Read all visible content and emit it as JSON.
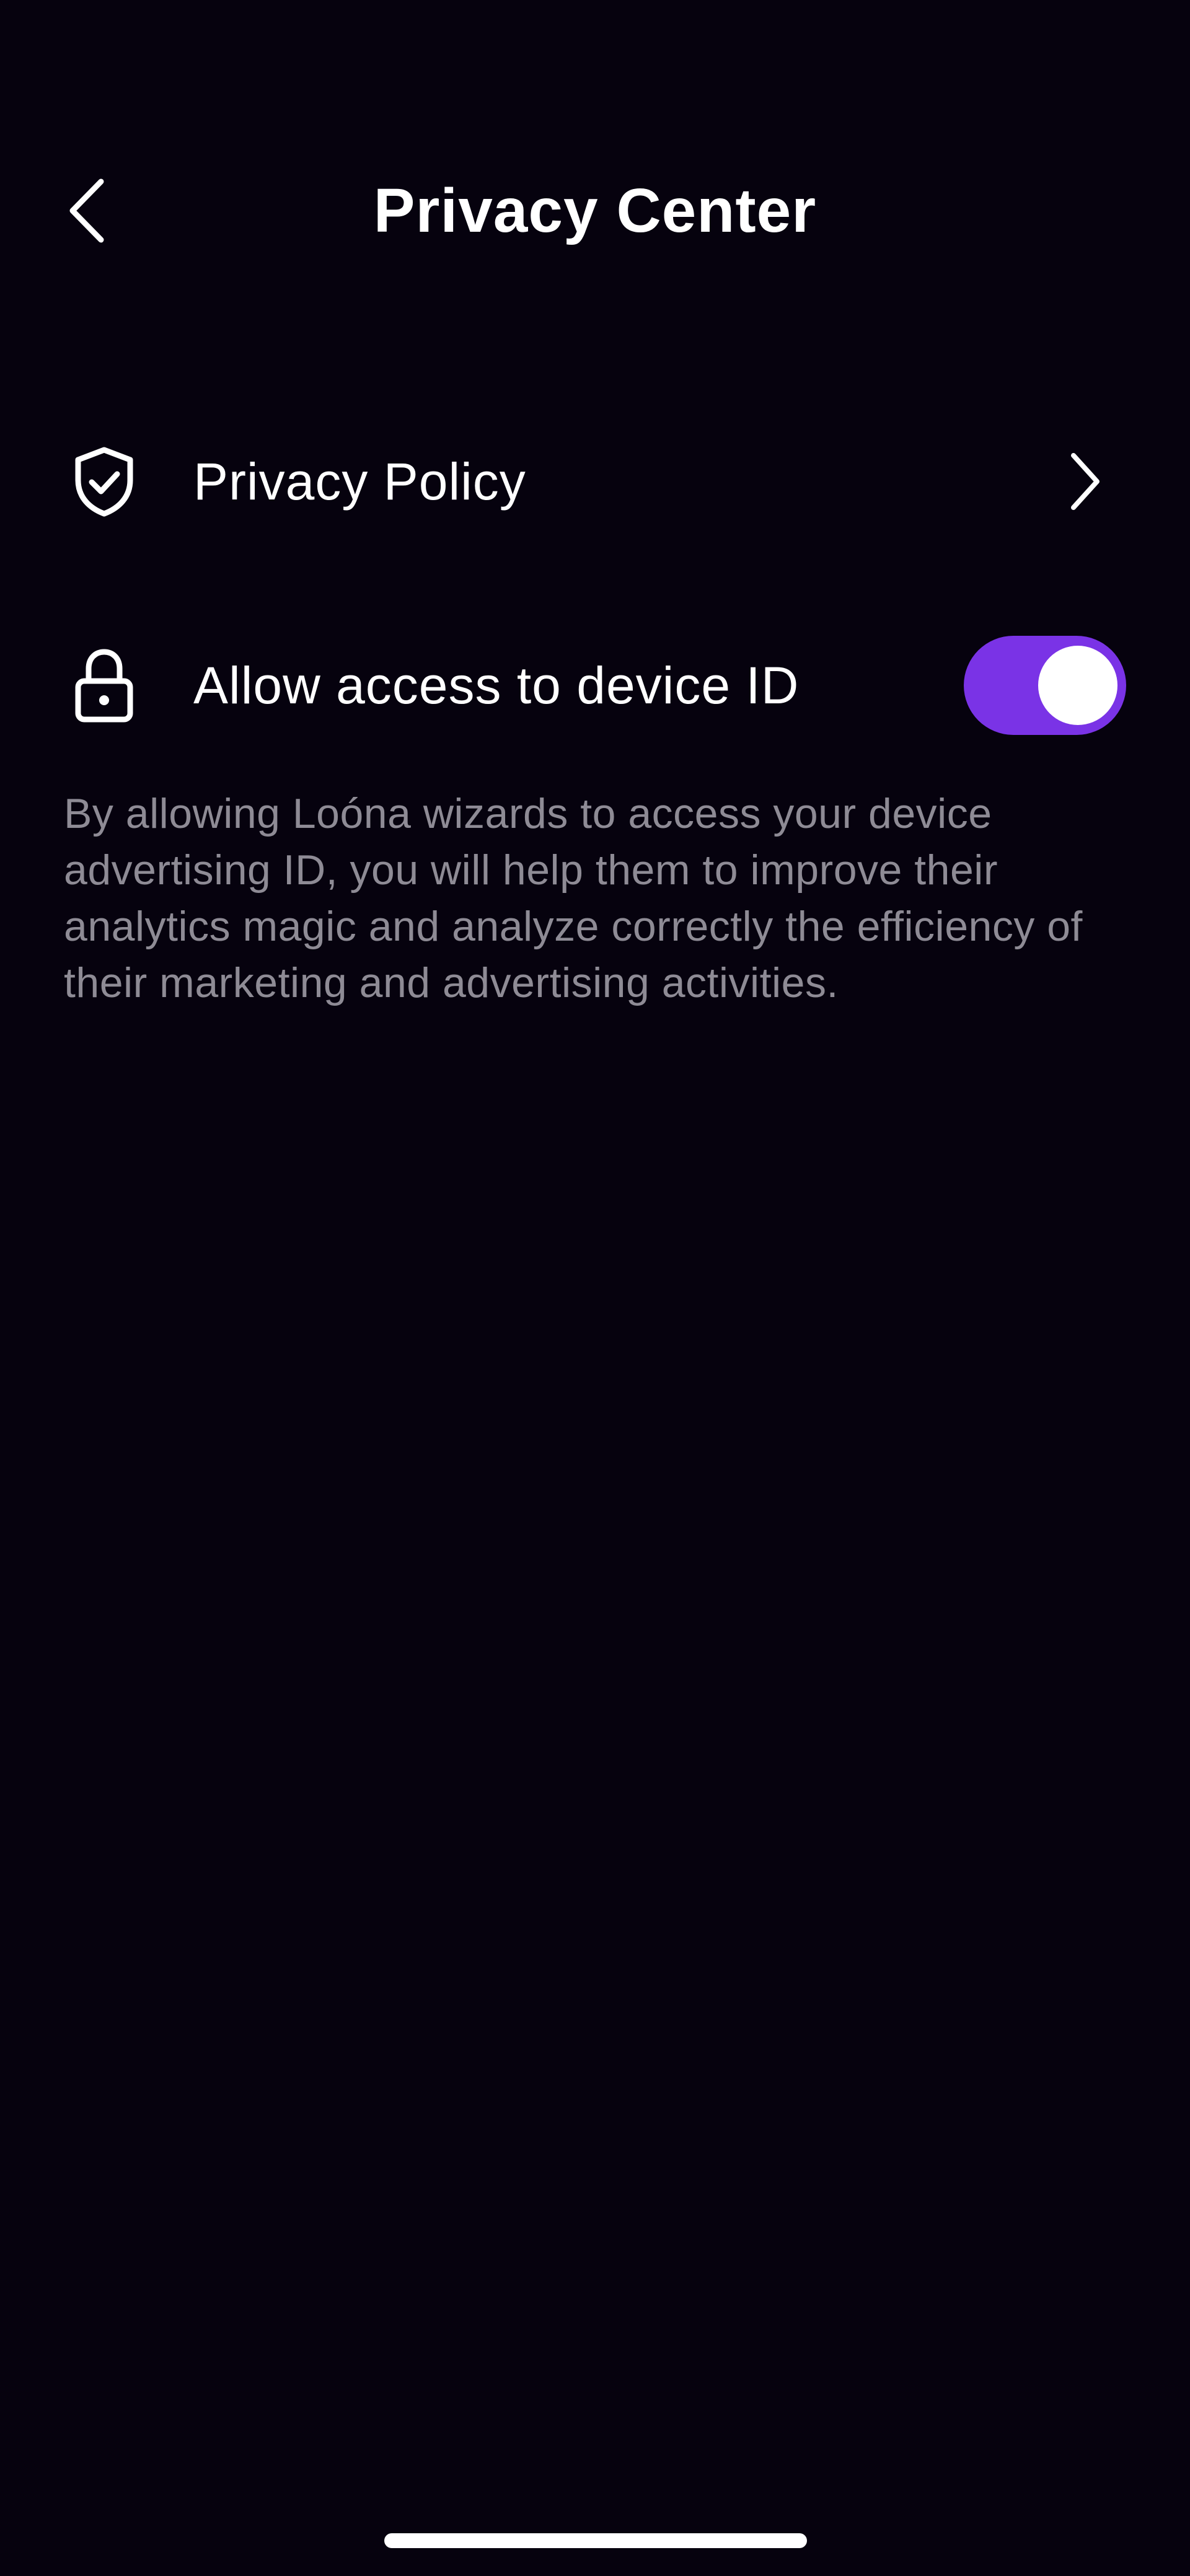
{
  "header": {
    "title": "Privacy Center",
    "back_icon": "chevron-left-icon"
  },
  "rows": {
    "privacy_policy": {
      "label": "Privacy Policy",
      "icon": "shield-check-icon",
      "trailing_icon": "chevron-right-icon"
    },
    "device_id": {
      "label": "Allow access to device ID",
      "icon": "lock-icon",
      "toggle_on": true
    }
  },
  "description": "By allowing Loóna wizards to access your device advertising ID, you will help them to improve their analytics magic and analyze correctly the efficiency of their marketing and advertising activities.",
  "colors": {
    "background": "#06020e",
    "accent": "#7a33e6",
    "text_primary": "#ffffff",
    "text_secondary": "#8e8b95"
  }
}
